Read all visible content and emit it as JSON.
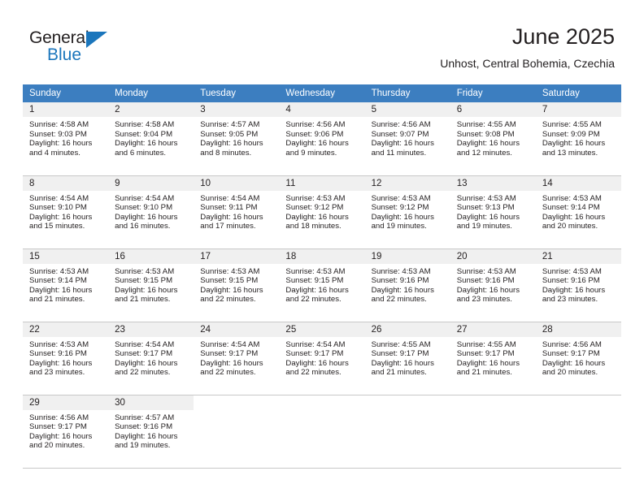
{
  "logo": {
    "word_one": "General",
    "word_two": "Blue",
    "triangle_icon": "triangle-icon",
    "brand_color": "#1b76bc"
  },
  "header": {
    "title": "June 2025",
    "subtitle": "Unhost, Central Bohemia, Czechia"
  },
  "colors": {
    "header_blue": "#3c7ec0",
    "daynum_band": "#f0f0f0",
    "row_divider": "#c8c8c8",
    "text": "#231f20"
  },
  "calendar": {
    "weekday_headers": [
      "Sunday",
      "Monday",
      "Tuesday",
      "Wednesday",
      "Thursday",
      "Friday",
      "Saturday"
    ],
    "labels": {
      "sunrise": "Sunrise:",
      "sunset": "Sunset:",
      "daylight": "Daylight:"
    },
    "weeks": [
      [
        {
          "day": "1",
          "sunrise": "Sunrise: 4:58 AM",
          "sunset": "Sunset: 9:03 PM",
          "daylight_line1": "Daylight: 16 hours",
          "daylight_line2": "and 4 minutes."
        },
        {
          "day": "2",
          "sunrise": "Sunrise: 4:58 AM",
          "sunset": "Sunset: 9:04 PM",
          "daylight_line1": "Daylight: 16 hours",
          "daylight_line2": "and 6 minutes."
        },
        {
          "day": "3",
          "sunrise": "Sunrise: 4:57 AM",
          "sunset": "Sunset: 9:05 PM",
          "daylight_line1": "Daylight: 16 hours",
          "daylight_line2": "and 8 minutes."
        },
        {
          "day": "4",
          "sunrise": "Sunrise: 4:56 AM",
          "sunset": "Sunset: 9:06 PM",
          "daylight_line1": "Daylight: 16 hours",
          "daylight_line2": "and 9 minutes."
        },
        {
          "day": "5",
          "sunrise": "Sunrise: 4:56 AM",
          "sunset": "Sunset: 9:07 PM",
          "daylight_line1": "Daylight: 16 hours",
          "daylight_line2": "and 11 minutes."
        },
        {
          "day": "6",
          "sunrise": "Sunrise: 4:55 AM",
          "sunset": "Sunset: 9:08 PM",
          "daylight_line1": "Daylight: 16 hours",
          "daylight_line2": "and 12 minutes."
        },
        {
          "day": "7",
          "sunrise": "Sunrise: 4:55 AM",
          "sunset": "Sunset: 9:09 PM",
          "daylight_line1": "Daylight: 16 hours",
          "daylight_line2": "and 13 minutes."
        }
      ],
      [
        {
          "day": "8",
          "sunrise": "Sunrise: 4:54 AM",
          "sunset": "Sunset: 9:10 PM",
          "daylight_line1": "Daylight: 16 hours",
          "daylight_line2": "and 15 minutes."
        },
        {
          "day": "9",
          "sunrise": "Sunrise: 4:54 AM",
          "sunset": "Sunset: 9:10 PM",
          "daylight_line1": "Daylight: 16 hours",
          "daylight_line2": "and 16 minutes."
        },
        {
          "day": "10",
          "sunrise": "Sunrise: 4:54 AM",
          "sunset": "Sunset: 9:11 PM",
          "daylight_line1": "Daylight: 16 hours",
          "daylight_line2": "and 17 minutes."
        },
        {
          "day": "11",
          "sunrise": "Sunrise: 4:53 AM",
          "sunset": "Sunset: 9:12 PM",
          "daylight_line1": "Daylight: 16 hours",
          "daylight_line2": "and 18 minutes."
        },
        {
          "day": "12",
          "sunrise": "Sunrise: 4:53 AM",
          "sunset": "Sunset: 9:12 PM",
          "daylight_line1": "Daylight: 16 hours",
          "daylight_line2": "and 19 minutes."
        },
        {
          "day": "13",
          "sunrise": "Sunrise: 4:53 AM",
          "sunset": "Sunset: 9:13 PM",
          "daylight_line1": "Daylight: 16 hours",
          "daylight_line2": "and 19 minutes."
        },
        {
          "day": "14",
          "sunrise": "Sunrise: 4:53 AM",
          "sunset": "Sunset: 9:14 PM",
          "daylight_line1": "Daylight: 16 hours",
          "daylight_line2": "and 20 minutes."
        }
      ],
      [
        {
          "day": "15",
          "sunrise": "Sunrise: 4:53 AM",
          "sunset": "Sunset: 9:14 PM",
          "daylight_line1": "Daylight: 16 hours",
          "daylight_line2": "and 21 minutes."
        },
        {
          "day": "16",
          "sunrise": "Sunrise: 4:53 AM",
          "sunset": "Sunset: 9:15 PM",
          "daylight_line1": "Daylight: 16 hours",
          "daylight_line2": "and 21 minutes."
        },
        {
          "day": "17",
          "sunrise": "Sunrise: 4:53 AM",
          "sunset": "Sunset: 9:15 PM",
          "daylight_line1": "Daylight: 16 hours",
          "daylight_line2": "and 22 minutes."
        },
        {
          "day": "18",
          "sunrise": "Sunrise: 4:53 AM",
          "sunset": "Sunset: 9:15 PM",
          "daylight_line1": "Daylight: 16 hours",
          "daylight_line2": "and 22 minutes."
        },
        {
          "day": "19",
          "sunrise": "Sunrise: 4:53 AM",
          "sunset": "Sunset: 9:16 PM",
          "daylight_line1": "Daylight: 16 hours",
          "daylight_line2": "and 22 minutes."
        },
        {
          "day": "20",
          "sunrise": "Sunrise: 4:53 AM",
          "sunset": "Sunset: 9:16 PM",
          "daylight_line1": "Daylight: 16 hours",
          "daylight_line2": "and 23 minutes."
        },
        {
          "day": "21",
          "sunrise": "Sunrise: 4:53 AM",
          "sunset": "Sunset: 9:16 PM",
          "daylight_line1": "Daylight: 16 hours",
          "daylight_line2": "and 23 minutes."
        }
      ],
      [
        {
          "day": "22",
          "sunrise": "Sunrise: 4:53 AM",
          "sunset": "Sunset: 9:16 PM",
          "daylight_line1": "Daylight: 16 hours",
          "daylight_line2": "and 23 minutes."
        },
        {
          "day": "23",
          "sunrise": "Sunrise: 4:54 AM",
          "sunset": "Sunset: 9:17 PM",
          "daylight_line1": "Daylight: 16 hours",
          "daylight_line2": "and 22 minutes."
        },
        {
          "day": "24",
          "sunrise": "Sunrise: 4:54 AM",
          "sunset": "Sunset: 9:17 PM",
          "daylight_line1": "Daylight: 16 hours",
          "daylight_line2": "and 22 minutes."
        },
        {
          "day": "25",
          "sunrise": "Sunrise: 4:54 AM",
          "sunset": "Sunset: 9:17 PM",
          "daylight_line1": "Daylight: 16 hours",
          "daylight_line2": "and 22 minutes."
        },
        {
          "day": "26",
          "sunrise": "Sunrise: 4:55 AM",
          "sunset": "Sunset: 9:17 PM",
          "daylight_line1": "Daylight: 16 hours",
          "daylight_line2": "and 21 minutes."
        },
        {
          "day": "27",
          "sunrise": "Sunrise: 4:55 AM",
          "sunset": "Sunset: 9:17 PM",
          "daylight_line1": "Daylight: 16 hours",
          "daylight_line2": "and 21 minutes."
        },
        {
          "day": "28",
          "sunrise": "Sunrise: 4:56 AM",
          "sunset": "Sunset: 9:17 PM",
          "daylight_line1": "Daylight: 16 hours",
          "daylight_line2": "and 20 minutes."
        }
      ],
      [
        {
          "day": "29",
          "sunrise": "Sunrise: 4:56 AM",
          "sunset": "Sunset: 9:17 PM",
          "daylight_line1": "Daylight: 16 hours",
          "daylight_line2": "and 20 minutes."
        },
        {
          "day": "30",
          "sunrise": "Sunrise: 4:57 AM",
          "sunset": "Sunset: 9:16 PM",
          "daylight_line1": "Daylight: 16 hours",
          "daylight_line2": "and 19 minutes."
        },
        {
          "day": "",
          "sunrise": "",
          "sunset": "",
          "daylight_line1": "",
          "daylight_line2": ""
        },
        {
          "day": "",
          "sunrise": "",
          "sunset": "",
          "daylight_line1": "",
          "daylight_line2": ""
        },
        {
          "day": "",
          "sunrise": "",
          "sunset": "",
          "daylight_line1": "",
          "daylight_line2": ""
        },
        {
          "day": "",
          "sunrise": "",
          "sunset": "",
          "daylight_line1": "",
          "daylight_line2": ""
        },
        {
          "day": "",
          "sunrise": "",
          "sunset": "",
          "daylight_line1": "",
          "daylight_line2": ""
        }
      ]
    ]
  }
}
